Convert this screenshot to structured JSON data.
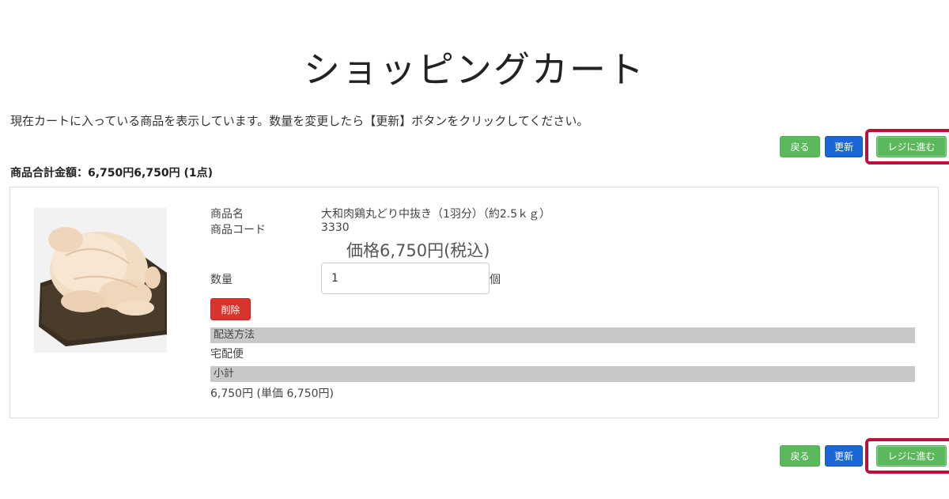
{
  "page": {
    "title": "ショッピングカート",
    "description": "現在カートに入っている商品を表示しています。数量を変更したら【更新】ボタンをクリックしてください。"
  },
  "actions": {
    "back_label": "戻る",
    "update_label": "更新",
    "checkout_label": "レジに進む"
  },
  "summary": {
    "total_text": "商品合計金額：6,750円6,750円 (1点)"
  },
  "item": {
    "name_label": "商品名",
    "name_value": "大和肉鶏丸どり中抜き（1羽分）（約2.5ｋｇ）",
    "code_label": "商品コード",
    "code_value": "3330",
    "price_text": "価格6,750円(税込)",
    "quantity_label": "数量",
    "quantity_value": "1",
    "quantity_unit": "個",
    "delete_label": "削除",
    "shipping_header": "配送方法",
    "shipping_value": "宅配便",
    "subtotal_header": "小計",
    "subtotal_value": "6,750円 (単価 6,750円)"
  },
  "colors": {
    "highlight_border": "#b8123c",
    "green_button": "#5cb85c",
    "blue_button": "#1b66d6",
    "red_button": "#d9342b",
    "section_bar": "#c8c8c8"
  }
}
